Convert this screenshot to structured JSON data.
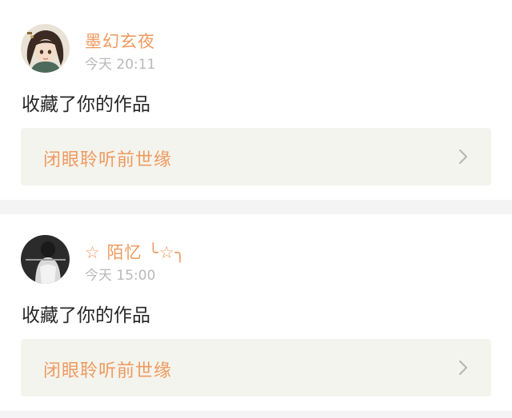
{
  "notifications": [
    {
      "username": "墨幻玄夜",
      "time": "今天 20:11",
      "action": "收藏了你的作品",
      "work_title": "闭眼聆听前世缘",
      "avatar_icon": "anime-character-avatar-icon"
    },
    {
      "username": "☆ 陌忆 ╰☆╮",
      "time": "今天 15:00",
      "action": "收藏了你的作品",
      "work_title": "闭眼聆听前世缘",
      "avatar_icon": "photo-avatar-icon"
    }
  ],
  "colors": {
    "accent": "#ef9a5f",
    "time_gray": "#b8b8b8",
    "link_bg": "#f4f4ee",
    "page_bg": "#f4f4f4"
  }
}
